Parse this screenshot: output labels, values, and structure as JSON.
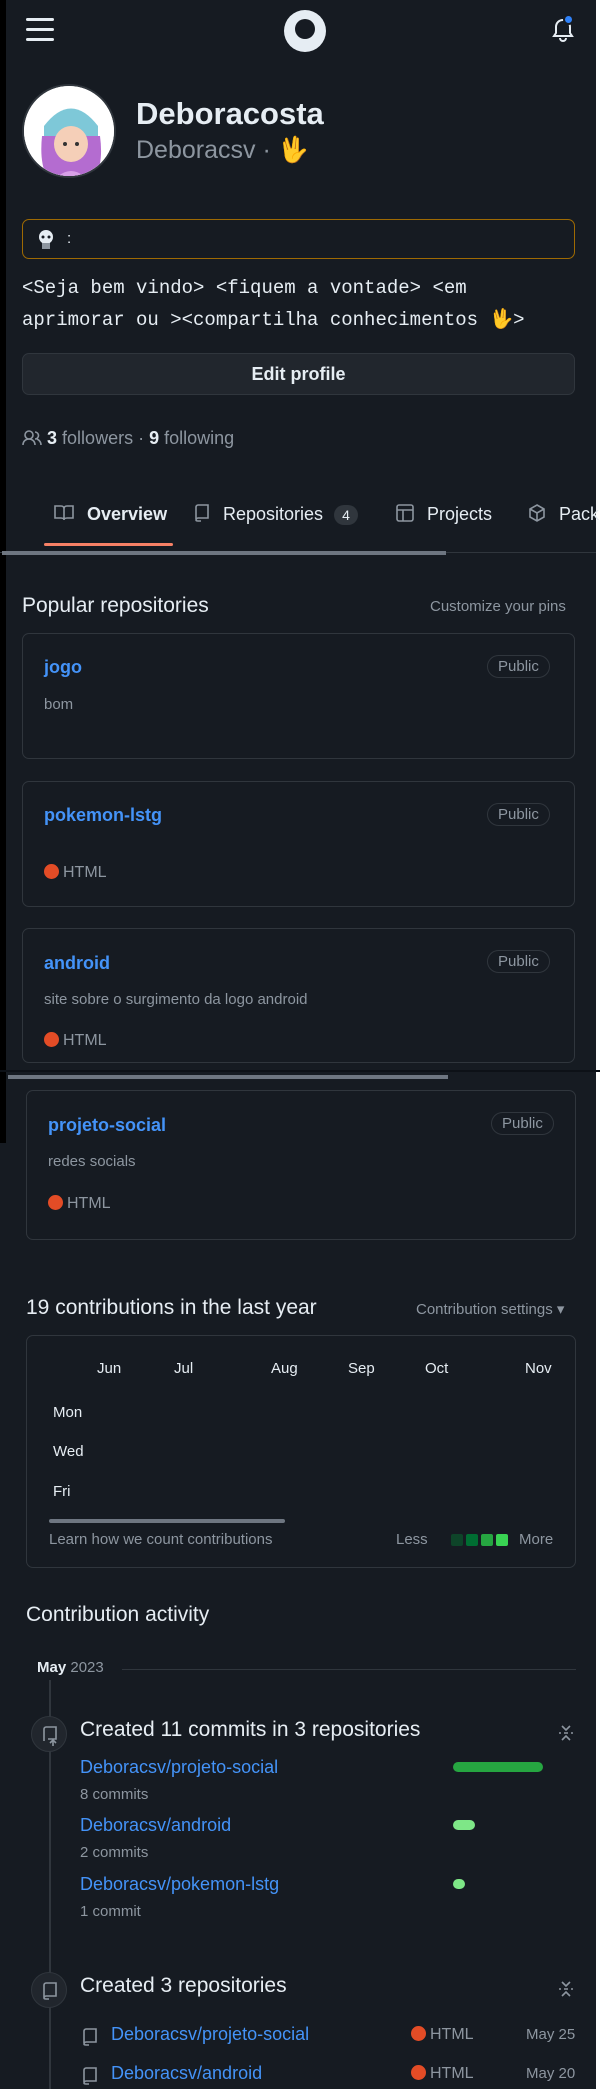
{
  "header": {
    "menu": "menu-icon",
    "logo": "github-logo",
    "notifications": "bell-icon"
  },
  "profile": {
    "name": "Deboracosta",
    "username": "Deboracsv",
    "status_sep": "·",
    "status_emoji": "🖖",
    "status_card_text": ":",
    "bio": "<Seja bem vindo> <fiquem a vontade> <em aprimorar ou ><compartilha conhecimentos 🖖>",
    "edit_label": "Edit profile",
    "followers_count": "3",
    "followers_label": "followers",
    "following_sep": "·",
    "following_count": "9",
    "following_label": "following"
  },
  "tabs": [
    {
      "label": "Overview",
      "icon": "book-icon"
    },
    {
      "label": "Repositories",
      "icon": "repo-icon",
      "count": "4"
    },
    {
      "label": "Projects",
      "icon": "table-icon"
    },
    {
      "label": "Pack",
      "icon": "package-icon"
    }
  ],
  "popular": {
    "title": "Popular repositories",
    "customize": "Customize your pins",
    "repos": [
      {
        "name": "jogo",
        "visibility": "Public",
        "description": "bom",
        "language": ""
      },
      {
        "name": "pokemon-lstg",
        "visibility": "Public",
        "description": "",
        "language": "HTML"
      },
      {
        "name": "android",
        "visibility": "Public",
        "description": "site sobre o surgimento da logo android",
        "language": "HTML"
      },
      {
        "name": "projeto-social",
        "visibility": "Public",
        "description": "redes socials",
        "language": "HTML"
      }
    ]
  },
  "contributions": {
    "title": "19 contributions in the last year",
    "settings": "Contribution settings ▾",
    "months": [
      "Jun",
      "Jul",
      "Aug",
      "Sep",
      "Oct",
      "Nov"
    ],
    "days": [
      "Mon",
      "Wed",
      "Fri"
    ],
    "learn": "Learn how we count contributions",
    "less": "Less",
    "more": "More",
    "legend_colors": [
      "#0e4429",
      "#006d32",
      "#26a641",
      "#39d353"
    ]
  },
  "activity": {
    "title": "Contribution activity",
    "month": "May",
    "year": "2023",
    "commits": {
      "title": "Created 11 commits in 3 repositories",
      "items": [
        {
          "repo": "Deboracsv/projeto-social",
          "count": "8 commits",
          "fraction": 0.73,
          "color": "#26a641"
        },
        {
          "repo": "Deboracsv/android",
          "count": "2 commits",
          "fraction": 0.18,
          "color": "#7ee787"
        },
        {
          "repo": "Deboracsv/pokemon-lstg",
          "count": "1 commit",
          "fraction": 0.09,
          "color": "#7ee787"
        }
      ]
    },
    "created": {
      "title": "Created 3 repositories",
      "items": [
        {
          "repo": "Deboracsv/projeto-social",
          "language": "HTML",
          "date": "May 25"
        },
        {
          "repo": "Deboracsv/android",
          "language": "HTML",
          "date": "May 20"
        }
      ]
    }
  }
}
